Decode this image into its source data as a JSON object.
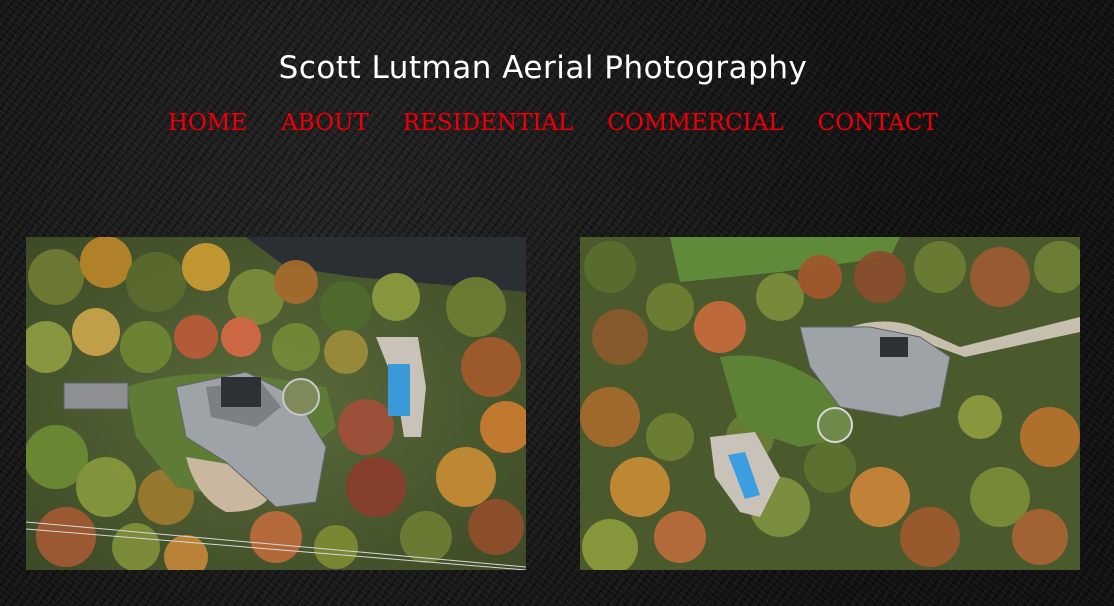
{
  "site": {
    "title": "Scott Lutman Aerial Photography"
  },
  "nav": {
    "items": [
      {
        "label": "HOME"
      },
      {
        "label": "ABOUT"
      },
      {
        "label": "RESIDENTIAL"
      },
      {
        "label": "COMMERCIAL"
      },
      {
        "label": "CONTACT"
      }
    ],
    "color": "#e8000b"
  },
  "gallery": {
    "photos": [
      {
        "subject": "aerial view of estate with pool, autumn trees"
      },
      {
        "subject": "aerial view of estate with pool and driveway, autumn trees"
      }
    ]
  }
}
